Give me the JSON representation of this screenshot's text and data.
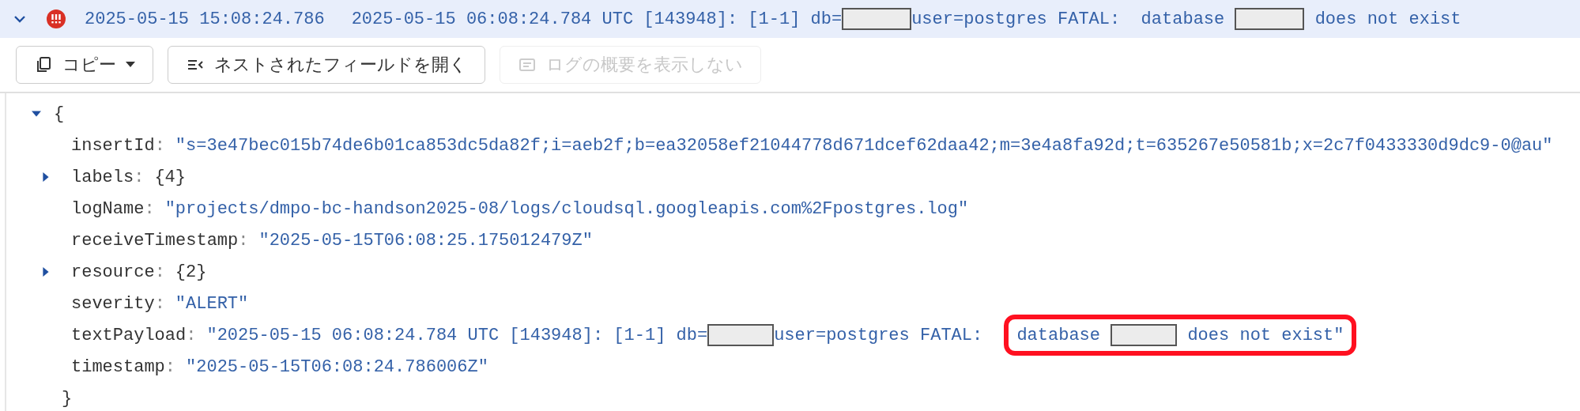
{
  "entry": {
    "expanded": true,
    "color": "#d93025",
    "timestamp": "2025-05-15 15:08:24.786",
    "message": [
      {
        "kind": "text",
        "text": "2025-05-15 06:08:24.784 UTC [143948]: [1-1] db="
      },
      {
        "kind": "redacted"
      },
      {
        "kind": "text",
        "text": "user=postgres FATAL:  database "
      },
      {
        "kind": "redacted"
      },
      {
        "kind": "text",
        "text": " does not exist"
      }
    ]
  },
  "toolbar": [
    {
      "kind": "copy",
      "label": "コピー",
      "disabled": false
    },
    {
      "kind": "expand",
      "label": "ネストされたフィールドを開く",
      "disabled": false
    },
    {
      "kind": "summary",
      "label": "ログの概要を表示しない",
      "disabled": true
    }
  ],
  "tree": {
    "open": "{",
    "close": "}",
    "expanded": true,
    "fields": [
      {
        "kind": "value",
        "key": "insertId",
        "sep": ":",
        "value": "\"s=3e47bec015b74de6b01ca853dc5da82f;i=aeb2f;b=ea32058ef21044778d671dcef62daa42;m=3e4a8fa92d;t=635267e50581b;x=2c7f0433330d9dc9-0@au\""
      },
      {
        "kind": "object",
        "key": "labels",
        "sep": ":",
        "value": "{4}",
        "expanded": false
      },
      {
        "kind": "value",
        "key": "logName",
        "sep": ":",
        "value": "\"projects/dmpo-bc-handson2025-08/logs/cloudsql.googleapis.com%2Fpostgres.log\""
      },
      {
        "kind": "value",
        "key": "receiveTimestamp",
        "sep": ":",
        "value": "\"2025-05-15T06:08:25.175012479Z\""
      },
      {
        "kind": "object",
        "key": "resource",
        "sep": ":",
        "value": "{2}",
        "expanded": false
      },
      {
        "kind": "value",
        "key": "severity",
        "sep": ":",
        "value": "\"ALERT\""
      },
      {
        "kind": "parts",
        "key": "textPayload",
        "sep": ":",
        "parts": [
          {
            "kind": "text",
            "text": "\"2025-05-15 06:08:24.784 UTC [143948]: [1-1] db="
          },
          {
            "kind": "redacted"
          },
          {
            "kind": "text",
            "text": "user=postgres FATAL: "
          }
        ],
        "highlighted": [
          {
            "kind": "text",
            "text": "database "
          },
          {
            "kind": "redacted"
          },
          {
            "kind": "text",
            "text": " does not exist\""
          }
        ]
      },
      {
        "kind": "value",
        "key": "timestamp",
        "sep": ":",
        "value": "\"2025-05-15T06:08:24.786006Z\""
      }
    ]
  }
}
